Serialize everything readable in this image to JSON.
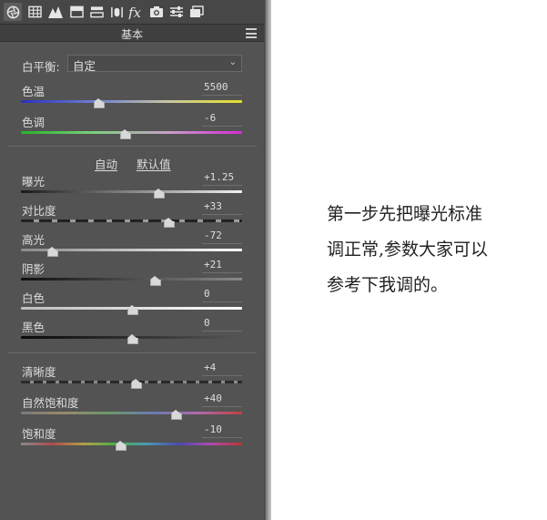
{
  "panel": {
    "title": "基本",
    "toolbar_icons": [
      "aperture-icon",
      "grid-icon",
      "mountain-icon",
      "split-toning-icon",
      "detail-icon",
      "lens-icon",
      "fx-icon",
      "camera-icon",
      "sliders-icon",
      "presets-icon"
    ],
    "white_balance": {
      "label": "白平衡:",
      "value": "自定"
    },
    "auto_label": "自动",
    "default_label": "默认值",
    "sliders": [
      {
        "id": "temp",
        "label": "色温",
        "value": "5500",
        "position": 0.35
      },
      {
        "id": "tint",
        "label": "色调",
        "value": "-6",
        "position": 0.47
      },
      {
        "id": "exposure",
        "label": "曝光",
        "value": "+1.25",
        "position": 0.62
      },
      {
        "id": "contrast",
        "label": "对比度",
        "value": "+33",
        "position": 0.665
      },
      {
        "id": "highlights",
        "label": "高光",
        "value": "-72",
        "position": 0.14
      },
      {
        "id": "shadows",
        "label": "阴影",
        "value": "+21",
        "position": 0.605
      },
      {
        "id": "whites",
        "label": "白色",
        "value": "0",
        "position": 0.5
      },
      {
        "id": "blacks",
        "label": "黑色",
        "value": "0",
        "position": 0.5
      },
      {
        "id": "clarity",
        "label": "清晰度",
        "value": "+4",
        "position": 0.52
      },
      {
        "id": "vibrance",
        "label": "自然饱和度",
        "value": "+40",
        "position": 0.7
      },
      {
        "id": "saturation",
        "label": "饱和度",
        "value": "-10",
        "position": 0.45
      }
    ]
  },
  "caption": {
    "lines": [
      "第一步先把曝光标准",
      "调正常,参数大家可以",
      "参考下我调的。"
    ]
  },
  "colors": {
    "panel_bg": "#535353",
    "temp_track": "linear-gradient(to right,#2b2fbf,#6f7fd0,#c7c7a0,#e6e22a)",
    "tint_track": "linear-gradient(to right,#27b427,#7fcf7f,#c8a0c8,#d62ad6)"
  }
}
